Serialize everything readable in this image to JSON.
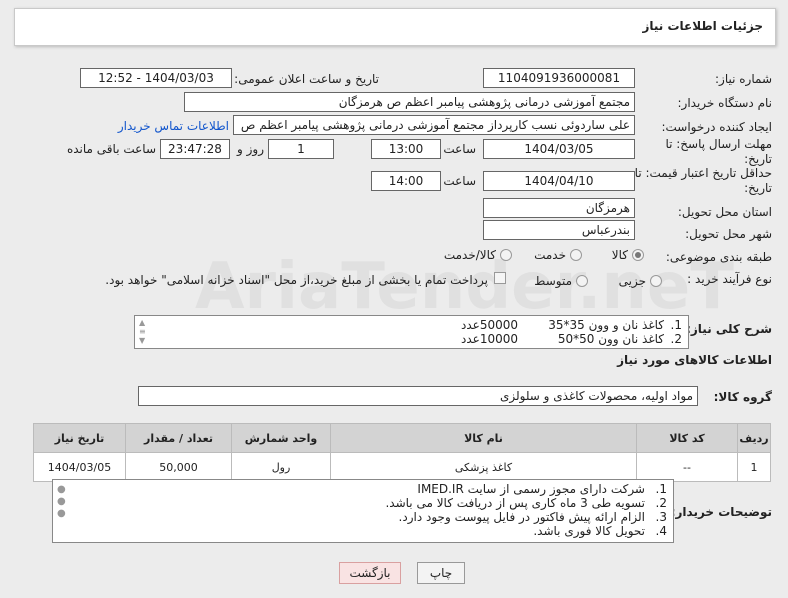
{
  "header_title": "جزئیات اطلاعات نیاز",
  "fields": {
    "need_number_label": "شماره نیاز:",
    "need_number": "1104091936000081",
    "announce_label": "تاریخ و ساعت اعلان عمومی:",
    "announce_value": "1404/03/03 - 12:52",
    "buyer_org_label": "نام دستگاه خریدار:",
    "buyer_org": "مجتمع آموزشی درمانی پژوهشی پیامبر اعظم ص  هرمزگان",
    "creator_label": "ایجاد کننده درخواست:",
    "creator": "علی ساردوئی نسب کارپرداز مجتمع آموزشی درمانی پژوهشی پیامبر اعظم ص",
    "contact_link": "اطلاعات تماس خریدار",
    "reply_deadline_label": "مهلت ارسال پاسخ: تا تاریخ:",
    "reply_date": "1404/03/05",
    "time_label": "ساعت",
    "reply_time": "13:00",
    "days_count": "1",
    "days_label": "روز و",
    "remaining_time": "23:47:28",
    "remaining_label": "ساعت باقی مانده",
    "price_validity_label": "حداقل تاریخ اعتبار قیمت: تا تاریخ:",
    "validity_date": "1404/04/10",
    "validity_time": "14:00",
    "province_label": "استان محل تحویل:",
    "province": "هرمزگان",
    "city_label": "شهر محل تحویل:",
    "city": "بندرعباس",
    "category_label": "طبقه بندی موضوعی:",
    "category_options": [
      "کالا",
      "خدمت",
      "کالا/خدمت"
    ],
    "process_label": "نوع فرآیند خرید :",
    "process_options": [
      "جزیی",
      "متوسط"
    ],
    "payment_note": "پرداخت تمام یا بخشی از مبلغ خرید،از محل \"اسناد خزانه اسلامی\" خواهد بود."
  },
  "summary": {
    "label": "شرح کلی نیاز:",
    "lines": [
      {
        "num": "1.",
        "item": "کاغذ نان و وون 35*35",
        "qty": "50000عدد"
      },
      {
        "num": "2.",
        "item": "کاغذ نان وون 50*50",
        "qty": "10000عدد"
      }
    ]
  },
  "goods_info_title": "اطلاعات کالاهای مورد نیاز",
  "goods_group_label": "گروه کالا:",
  "goods_group": "مواد اولیه، محصولات کاغذی و سلولزی",
  "table": {
    "headers": [
      "ردیف",
      "کد کالا",
      "نام کالا",
      "واحد شمارش",
      "تعداد / مقدار",
      "تاریخ نیاز"
    ],
    "rows": [
      [
        "1",
        "--",
        "کاغذ پزشکی",
        "رول",
        "50,000",
        "1404/03/05"
      ]
    ]
  },
  "buyer_notes": {
    "label": "توضیحات خریدار:",
    "lines": [
      {
        "num": "1.",
        "text": "شرکت دارای مجوز رسمی از سایت IMED.IR"
      },
      {
        "num": "2.",
        "text": "تسویه طی 3 ماه  کاری پس از دریافت کالا می باشد."
      },
      {
        "num": "3.",
        "text": "الزام ارائه پیش فاکتور در فایل پیوست وجود دارد."
      },
      {
        "num": "4.",
        "text": "تحویل کالا فوری باشد."
      }
    ]
  },
  "buttons": {
    "print": "چاپ",
    "back": "بازگشت"
  },
  "watermark": "AriaTender.neT"
}
